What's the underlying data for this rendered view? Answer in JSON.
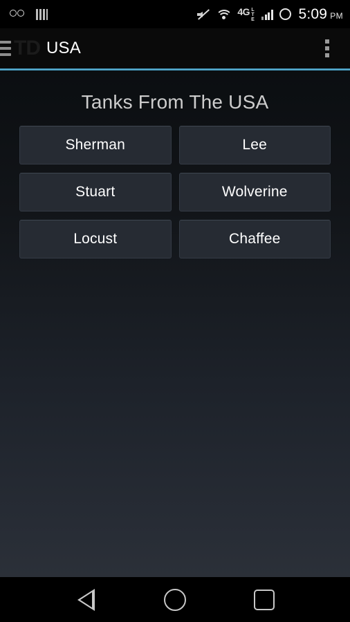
{
  "status_bar": {
    "left_icons": [
      {
        "name": "voicemail-icon"
      },
      {
        "name": "striped-bars-icon"
      }
    ],
    "right_icons": [
      {
        "name": "mute-icon"
      },
      {
        "name": "wifi-icon"
      },
      {
        "name": "network-type-icon",
        "label": "4G",
        "sublabel": "LTE"
      },
      {
        "name": "signal-bars-icon",
        "bars_filled": 3,
        "bars_total": 4
      },
      {
        "name": "circle-ring-icon"
      }
    ],
    "clock": "5:09",
    "clock_ampm": "PM"
  },
  "action_bar": {
    "menu_icon": "hamburger-icon",
    "logo_text": "TD",
    "title": "USA",
    "overflow_icon": "overflow-menu-icon",
    "accent_color": "#5fb2d4"
  },
  "content": {
    "heading": "Tanks From The USA",
    "tanks": [
      {
        "label": "Sherman"
      },
      {
        "label": "Lee"
      },
      {
        "label": "Stuart"
      },
      {
        "label": "Wolverine"
      },
      {
        "label": "Locust"
      },
      {
        "label": "Chaffee"
      }
    ]
  },
  "nav_bar": {
    "buttons": [
      {
        "name": "back-button",
        "icon": "triangle-left-icon"
      },
      {
        "name": "home-button",
        "icon": "circle-icon"
      },
      {
        "name": "recents-button",
        "icon": "square-icon"
      }
    ]
  }
}
